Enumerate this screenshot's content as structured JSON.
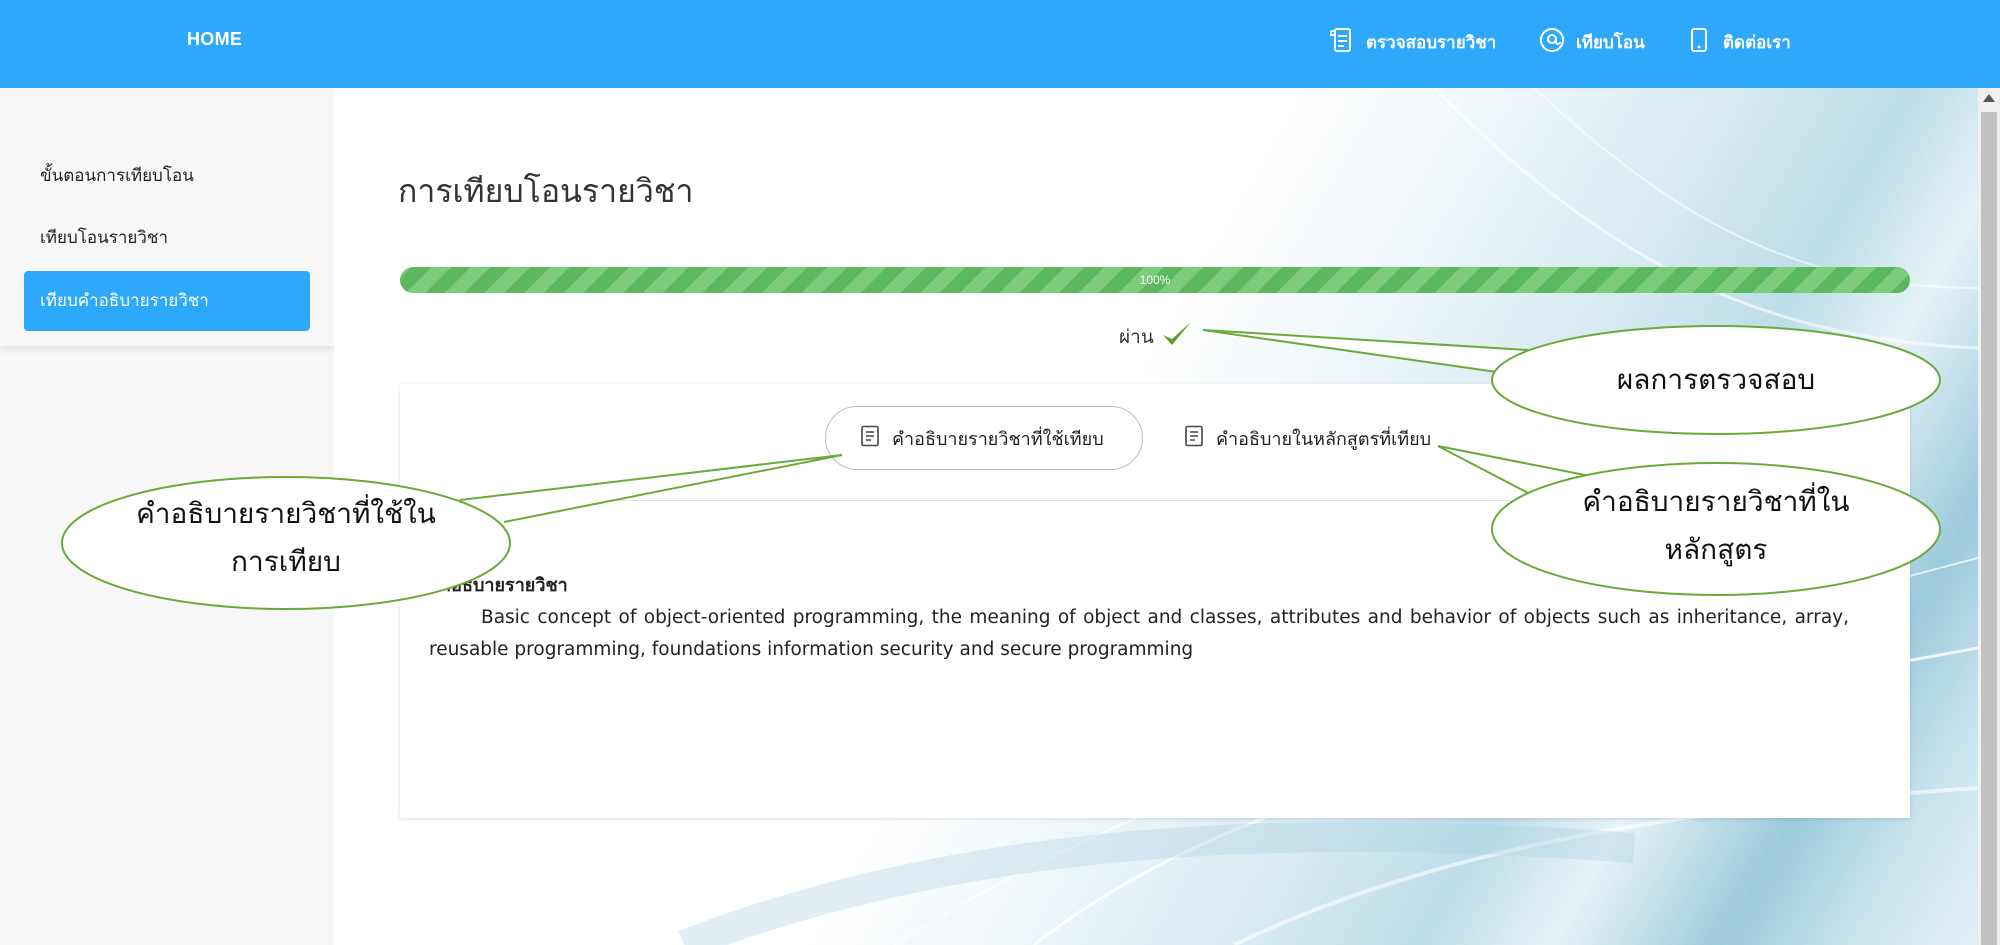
{
  "header": {
    "home_label": "HOME",
    "nav": [
      {
        "label": "ตรวจสอบรายวิชา",
        "icon": "document-scroll-icon"
      },
      {
        "label": "เทียบโอน",
        "icon": "at-sign-icon"
      },
      {
        "label": "ติดต่อเรา",
        "icon": "mobile-phone-icon"
      }
    ]
  },
  "sidebar": {
    "items": [
      {
        "label": "ขั้นตอนการเทียบโอน",
        "active": false
      },
      {
        "label": "เทียบโอนรายวิชา",
        "active": false
      },
      {
        "label": "เทียบคำอธิบายรายวิชา",
        "active": true
      }
    ]
  },
  "main": {
    "title": "การเทียบโอนรายวิชา",
    "progress": {
      "value": 100,
      "label": "100%"
    },
    "result": {
      "label": "ผ่าน",
      "icon": "checkmark-icon"
    },
    "tabs": [
      {
        "label": "คำอธิบายรายวิชาที่ใช้เทียบ",
        "icon": "document-icon",
        "active": true
      },
      {
        "label": "คำอธิบายในหลักสูตรที่เทียบ",
        "icon": "document-icon",
        "active": false
      }
    ],
    "description": {
      "heading": "คำอธิบายรายวิชา",
      "text": "Basic concept of object-oriented programming, the meaning of object and classes, attributes and behavior of objects such as inheritance, array, reusable programming, foundations information security and secure programming"
    }
  },
  "annotations": {
    "check_result": "ผลการตรวจสอบ",
    "used_description": [
      "คำอธิบายรายวิชาที่ใช้ใน",
      "การเทียบ"
    ],
    "curriculum_description": [
      "คำอธิบายรายวิชาที่ใน",
      "หลักสูตร"
    ]
  },
  "colors": {
    "header_blue": "#2ea8fb",
    "progress_green": "#5cb85c",
    "callout_green": "#6aaa3a",
    "check_green": "#5aa02c"
  }
}
